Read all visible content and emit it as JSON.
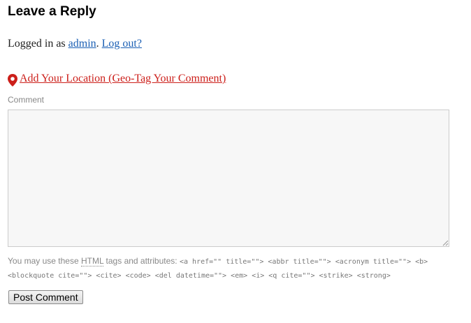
{
  "reply": {
    "title": "Leave a Reply",
    "logged_in_prefix": "Logged in as",
    "user_link": "admin",
    "sep": ".",
    "logout_link": "Log out?"
  },
  "geo": {
    "label": "Add Your Location (Geo-Tag Your Comment)",
    "icon": "map-pin-icon",
    "color": "#cc1f1a"
  },
  "comment": {
    "label": "Comment",
    "value": "",
    "placeholder": ""
  },
  "allowed_tags": {
    "prefix": "You may use these",
    "abbr": "HTML",
    "suffix": "tags and attributes:",
    "code": "<a href=\"\" title=\"\"> <abbr title=\"\"> <acronym title=\"\"> <b> <blockquote cite=\"\"> <cite> <code> <del datetime=\"\"> <em> <i> <q cite=\"\"> <strike> <strong>"
  },
  "submit": {
    "label": "Post Comment"
  },
  "colors": {
    "link": "#1a5fb4",
    "geo_link": "#cc1f1a",
    "muted": "#888888"
  }
}
